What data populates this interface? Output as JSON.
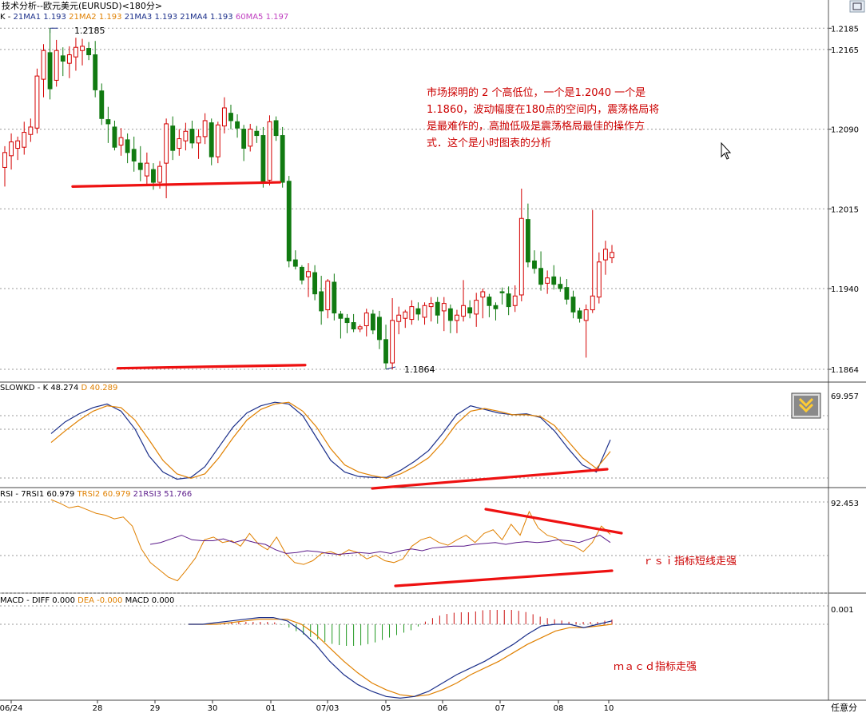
{
  "window": {
    "title": "技术分析--欧元美元(EURUSD)<180分>"
  },
  "colors": {
    "up": "#d40000",
    "down": "#117a11",
    "trend_line": "#ee1111",
    "annotation_text": "#cc0000",
    "grid": "#9a9a9a",
    "ma_blue": "#1b2f8a",
    "ma_orange": "#e08000",
    "ma_magenta": "#c040c0",
    "macd_up": "#cc1111",
    "macd_down": "#229922"
  },
  "icons": {
    "corner_button": "window-restore-icon",
    "panel_button": "double-chevron-down-icon"
  },
  "price_panel": {
    "legend": {
      "prefix": "K - ",
      "items": [
        {
          "label": "21MA1",
          "value": "1.193",
          "color": "#1b2f8a"
        },
        {
          "label": "21MA2",
          "value": "1.193",
          "color": "#e08000"
        },
        {
          "label": "21MA3",
          "value": "1.193",
          "color": "#1b2f8a"
        },
        {
          "label": "21MA4",
          "value": "1.193",
          "color": "#1b2f8a"
        },
        {
          "label": "60MA5",
          "value": "1.197",
          "color": "#c040c0"
        }
      ]
    },
    "y_ticks": [
      "1.2185",
      "1.2165",
      "1.2090",
      "1.2015",
      "1.1940",
      "1.1864"
    ],
    "high_marker": "1.2185",
    "low_marker": "1.1864",
    "annotation": [
      "市场探明的 2 个高低位，一个是1.2040   一个是",
      "1.1860，波动幅度在180点的空间内，震荡格局将",
      "是最难作的，高抛低吸是震荡格局最佳的操作方",
      "式．这个是小时图表的分析"
    ]
  },
  "chart_data": [
    {
      "type": "candlestick",
      "title": "技术分析--欧元美元(EURUSD)<180分>",
      "ylim": [
        1.1855,
        1.2195
      ],
      "x_tick_labels": [
        "06/24",
        "28",
        "29",
        "30",
        "01",
        "07/03",
        "05",
        "06",
        "07",
        "08",
        "10"
      ],
      "ohlc": [
        [
          1.2054,
          1.2074,
          1.2036,
          1.2068
        ],
        [
          1.2065,
          1.2086,
          1.2052,
          1.2078
        ],
        [
          1.2072,
          1.2083,
          1.2061,
          1.2079
        ],
        [
          1.2073,
          1.2097,
          1.2066,
          1.2087
        ],
        [
          1.2085,
          1.21,
          1.2078,
          1.2092
        ],
        [
          1.2091,
          1.2147,
          1.2086,
          1.214
        ],
        [
          1.2137,
          1.217,
          1.212,
          1.2164
        ],
        [
          1.2162,
          1.2185,
          1.2118,
          1.2128
        ],
        [
          1.2136,
          1.2174,
          1.213,
          1.2164
        ],
        [
          1.2159,
          1.2167,
          1.214,
          1.2154
        ],
        [
          1.2152,
          1.2168,
          1.2138,
          1.216
        ],
        [
          1.2158,
          1.2176,
          1.2145,
          1.2167
        ],
        [
          1.2164,
          1.2175,
          1.215,
          1.2168
        ],
        [
          1.2166,
          1.2172,
          1.2155,
          1.216
        ],
        [
          1.216,
          1.2173,
          1.212,
          1.2127
        ],
        [
          1.2126,
          1.2133,
          1.2094,
          1.21
        ],
        [
          1.2099,
          1.2111,
          1.2077,
          1.2095
        ],
        [
          1.2092,
          1.2098,
          1.207,
          1.2073
        ],
        [
          1.2075,
          1.2091,
          1.2065,
          1.2082
        ],
        [
          1.208,
          1.2086,
          1.2058,
          1.2068
        ],
        [
          1.2071,
          1.2083,
          1.205,
          1.206
        ],
        [
          1.2058,
          1.2074,
          1.2041,
          1.2052
        ],
        [
          1.2046,
          1.2068,
          1.2038,
          1.2058
        ],
        [
          1.2052,
          1.2058,
          1.2033,
          1.204
        ],
        [
          1.204,
          1.206,
          1.2034,
          1.2055
        ],
        [
          1.2058,
          1.21,
          1.2025,
          1.2095
        ],
        [
          1.2093,
          1.2102,
          1.2061,
          1.207
        ],
        [
          1.2072,
          1.209,
          1.2065,
          1.2081
        ],
        [
          1.2079,
          1.2096,
          1.207,
          1.2088
        ],
        [
          1.209,
          1.2098,
          1.2072,
          1.2077
        ],
        [
          1.2077,
          1.209,
          1.2062,
          1.2083
        ],
        [
          1.2083,
          1.2105,
          1.2076,
          1.2098
        ],
        [
          1.2096,
          1.21,
          1.2056,
          1.2064
        ],
        [
          1.2064,
          1.2097,
          1.2058,
          1.2094
        ],
        [
          1.2093,
          1.212,
          1.2086,
          1.211
        ],
        [
          1.2105,
          1.2113,
          1.209,
          1.2098
        ],
        [
          1.2097,
          1.2104,
          1.2082,
          1.2091
        ],
        [
          1.209,
          1.2094,
          1.206,
          1.2072
        ],
        [
          1.2074,
          1.2095,
          1.2069,
          1.209
        ],
        [
          1.2088,
          1.2093,
          1.2077,
          1.2084
        ],
        [
          1.2084,
          1.2092,
          1.2035,
          1.204
        ],
        [
          1.2042,
          1.2103,
          1.2037,
          1.2097
        ],
        [
          1.2098,
          1.2102,
          1.2079,
          1.2084
        ],
        [
          1.2084,
          1.2092,
          1.2035,
          1.204
        ],
        [
          1.2041,
          1.2046,
          1.196,
          1.1966
        ],
        [
          1.1967,
          1.1976,
          1.1958,
          1.1961
        ],
        [
          1.196,
          1.1962,
          1.1944,
          1.1948
        ],
        [
          1.1951,
          1.1964,
          1.1932,
          1.1956
        ],
        [
          1.1955,
          1.1962,
          1.1929,
          1.1935
        ],
        [
          1.1937,
          1.1952,
          1.1906,
          1.1919
        ],
        [
          1.192,
          1.1949,
          1.1912,
          1.1947
        ],
        [
          1.1946,
          1.1954,
          1.191,
          1.1917
        ],
        [
          1.1916,
          1.1919,
          1.1893,
          1.1912
        ],
        [
          1.1912,
          1.1916,
          1.1898,
          1.1908
        ],
        [
          1.1908,
          1.1916,
          1.1899,
          1.1902
        ],
        [
          1.1902,
          1.1906,
          1.1899,
          1.1904
        ],
        [
          1.1905,
          1.1921,
          1.1895,
          1.1917
        ],
        [
          1.1916,
          1.192,
          1.1897,
          1.1901
        ],
        [
          1.1913,
          1.1919,
          1.1883,
          1.1892
        ],
        [
          1.1892,
          1.1906,
          1.1864,
          1.187
        ],
        [
          1.187,
          1.1931,
          1.1864,
          1.191
        ],
        [
          1.1909,
          1.1923,
          1.1897,
          1.1915
        ],
        [
          1.1912,
          1.192,
          1.1903,
          1.1918
        ],
        [
          1.1911,
          1.1929,
          1.1906,
          1.1923
        ],
        [
          1.1921,
          1.1927,
          1.191,
          1.1916
        ],
        [
          1.1913,
          1.1927,
          1.1906,
          1.1924
        ],
        [
          1.1923,
          1.1932,
          1.1909,
          1.1926
        ],
        [
          1.1927,
          1.1932,
          1.1907,
          1.1915
        ],
        [
          1.1919,
          1.1932,
          1.19,
          1.1926
        ],
        [
          1.1921,
          1.1925,
          1.1898,
          1.191
        ],
        [
          1.191,
          1.192,
          1.1898,
          1.1915
        ],
        [
          1.1914,
          1.1948,
          1.1909,
          1.1924
        ],
        [
          1.1922,
          1.1929,
          1.1912,
          1.1917
        ],
        [
          1.1916,
          1.1936,
          1.1904,
          1.1929
        ],
        [
          1.1932,
          1.194,
          1.1912,
          1.1937
        ],
        [
          1.1932,
          1.1935,
          1.1913,
          1.1924
        ],
        [
          1.1924,
          1.1927,
          1.191,
          1.1921
        ],
        [
          1.1937,
          1.1941,
          1.1925,
          1.1936
        ],
        [
          1.1935,
          1.1942,
          1.1915,
          1.1923
        ],
        [
          1.1924,
          1.1943,
          1.1918,
          1.1933
        ],
        [
          1.1934,
          1.2034,
          1.1928,
          1.2006
        ],
        [
          1.2005,
          1.202,
          1.196,
          1.1965
        ],
        [
          1.1966,
          1.1976,
          1.1954,
          1.1959
        ],
        [
          1.1959,
          1.1975,
          1.1938,
          1.1944
        ],
        [
          1.1945,
          1.1957,
          1.1935,
          1.195
        ],
        [
          1.1951,
          1.1962,
          1.1939,
          1.1944
        ],
        [
          1.1944,
          1.1951,
          1.1937,
          1.194
        ],
        [
          1.1941,
          1.1949,
          1.1925,
          1.193
        ],
        [
          1.1932,
          1.1938,
          1.1912,
          1.1918
        ],
        [
          1.1919,
          1.1922,
          1.1908,
          1.1912
        ],
        [
          1.191,
          1.1925,
          1.1875,
          1.192
        ],
        [
          1.192,
          1.2014,
          1.1917,
          1.1933
        ],
        [
          1.1932,
          1.1974,
          1.1926,
          1.1965
        ],
        [
          1.1967,
          1.1985,
          1.1953,
          1.1977
        ],
        [
          1.1969,
          1.1981,
          1.1964,
          1.1974
        ]
      ],
      "trend_lines": [
        {
          "from": [
            10.5,
            1.2036
          ],
          "to": [
            42.6,
            1.204
          ]
        },
        {
          "from": [
            17.5,
            1.1865
          ],
          "to": [
            46.5,
            1.1868
          ]
        },
        {
          "from": [
            35.0,
            1.2041
          ],
          "to": [
            43.0,
            1.2041
          ]
        }
      ]
    },
    {
      "type": "line",
      "title": "SLOWKD",
      "ylim": [
        0,
        100
      ],
      "y_ticks": [
        "69.957"
      ],
      "series": [
        {
          "name": "K",
          "value": "48.274",
          "values": [
            55,
            68,
            77,
            84,
            88,
            80,
            60,
            30,
            12,
            4,
            6,
            18,
            40,
            62,
            78,
            86,
            90,
            88,
            75,
            50,
            25,
            12,
            7,
            6,
            6,
            14,
            24,
            36,
            55,
            76,
            86,
            82,
            78,
            76,
            77,
            73,
            58,
            38,
            20,
            12,
            48
          ]
        },
        {
          "name": "D",
          "value": "40.289",
          "values": [
            45,
            58,
            70,
            80,
            86,
            84,
            70,
            48,
            25,
            10,
            5,
            10,
            28,
            50,
            70,
            82,
            88,
            90,
            80,
            62,
            38,
            20,
            12,
            8,
            5,
            10,
            18,
            28,
            45,
            66,
            80,
            83,
            80,
            76,
            76,
            74,
            64,
            46,
            28,
            16,
            35
          ]
        }
      ]
    },
    {
      "type": "line",
      "title": "RSI",
      "ylim": [
        0,
        100
      ],
      "y_ticks": [
        "92.453"
      ],
      "series": [
        {
          "name": "7RSI1",
          "value": "60.979",
          "values": [
            99,
            95,
            90,
            92,
            88,
            84,
            82,
            78,
            80,
            70,
            45,
            30,
            22,
            14,
            10,
            22,
            35,
            55,
            58,
            52,
            54,
            48,
            62,
            50,
            44,
            58,
            40,
            30,
            28,
            32,
            40,
            42,
            38,
            44,
            41,
            34,
            38,
            32,
            30,
            34,
            48,
            55,
            58,
            52,
            49,
            55,
            60,
            52,
            62,
            66,
            55,
            72,
            60,
            86,
            68,
            60,
            57,
            50,
            48,
            42,
            52,
            70,
            61
          ]
        },
        {
          "name": "TRSI2",
          "value": "60.979",
          "values": [
            99,
            95,
            90,
            92,
            88,
            84,
            82,
            78,
            80,
            70,
            45,
            30,
            22,
            14,
            10,
            22,
            35,
            55,
            58,
            52,
            54,
            48,
            62,
            50,
            44,
            58,
            40,
            30,
            28,
            32,
            40,
            42,
            38,
            44,
            41,
            34,
            38,
            32,
            30,
            34,
            48,
            55,
            58,
            52,
            49,
            55,
            60,
            52,
            62,
            66,
            55,
            72,
            60,
            86,
            68,
            60,
            57,
            50,
            48,
            42,
            52,
            70,
            61
          ]
        },
        {
          "name": "21RSI3",
          "value": "51.766",
          "values": [
            50,
            52,
            56,
            60,
            55,
            54,
            54,
            56,
            52,
            55,
            52,
            50,
            44,
            40,
            41,
            43,
            42,
            40,
            39,
            40,
            41,
            40,
            42,
            40,
            43,
            45,
            43,
            46,
            47,
            48,
            48,
            50,
            51,
            52,
            50,
            52,
            53,
            52,
            53,
            55,
            54,
            52,
            56,
            60,
            52
          ]
        }
      ],
      "trend_lines": [
        {
          "from": [
            38.0,
            94
          ],
          "to": [
            46.0,
            78
          ]
        },
        {
          "from": [
            30.0,
            15
          ],
          "to": [
            46.0,
            38
          ]
        }
      ]
    },
    {
      "type": "bar",
      "title": "MACD",
      "y_ticks": [
        "0.001"
      ],
      "series": [
        {
          "name": "DIFF",
          "value": "0.000",
          "values": [
            0.0,
            0.0,
            0.0001,
            0.0002,
            0.0003,
            0.0004,
            0.0004,
            0.0002,
            -0.0004,
            -0.0012,
            -0.0022,
            -0.003,
            -0.0036,
            -0.004,
            -0.0043,
            -0.0044,
            -0.0043,
            -0.004,
            -0.0035,
            -0.003,
            -0.0026,
            -0.0022,
            -0.0017,
            -0.0012,
            -0.0006,
            -0.0001,
            0.0,
            0.0,
            -0.0002,
            0.0,
            0.0002
          ]
        },
        {
          "name": "DEA",
          "value": "-0.000",
          "values": [
            0.0,
            0.0,
            0.0,
            0.0001,
            0.0002,
            0.0003,
            0.0003,
            0.0003,
            0.0,
            -0.0006,
            -0.0014,
            -0.0022,
            -0.0029,
            -0.0035,
            -0.0039,
            -0.0042,
            -0.0043,
            -0.0042,
            -0.0039,
            -0.0035,
            -0.003,
            -0.0026,
            -0.0022,
            -0.0017,
            -0.0012,
            -0.0008,
            -0.0004,
            -0.0002,
            -0.0002,
            -0.0001,
            0.0
          ]
        },
        {
          "name": "MACD",
          "value": "0.000",
          "values": [
            0.0,
            0.0,
            0.0,
            0.0001,
            0.0001,
            0.0001,
            0.0001,
            -0.0001,
            -0.0004,
            -0.0006,
            -0.0008,
            -0.0009,
            -0.0009,
            -0.0008,
            -0.0006,
            -0.0004,
            -0.0002,
            0.0002,
            0.0004,
            0.0005,
            0.0005,
            0.0006,
            0.0006,
            0.0006,
            0.0005,
            0.0003,
            0.0002,
            0.0001,
            0.0001,
            0.0001,
            0.0002
          ]
        }
      ]
    }
  ],
  "annotations": {
    "rsi_note": "ｒｓｉ指标短线走强",
    "macd_note": "ｍａｃｄ指标走强"
  },
  "x_axis": {
    "labels": [
      "06/24",
      "28",
      "29",
      "30",
      "01",
      "07/03",
      "05",
      "06",
      "07",
      "08",
      "10"
    ],
    "corner_label": "任意分"
  }
}
